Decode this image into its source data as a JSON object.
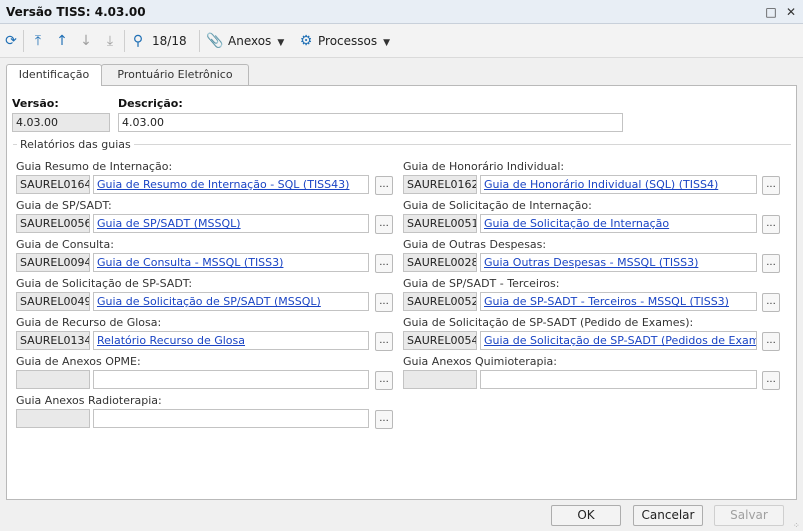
{
  "window": {
    "title": "Versão TISS: 4.03.00",
    "maximize_icon": "maximize-icon",
    "close_icon": "close-icon"
  },
  "toolbar": {
    "refresh_icon": "refresh-icon",
    "first_icon": "first-record-icon",
    "prev_icon": "previous-record-icon",
    "next_icon": "next-record-icon",
    "last_icon": "last-record-icon",
    "search_icon": "search-icon",
    "record_position": "18/18",
    "attachments_label": "Anexos",
    "processes_label": "Processos"
  },
  "tabs": [
    {
      "label": "Identificação",
      "active": true
    },
    {
      "label": "Prontuário Eletrônico",
      "active": false
    }
  ],
  "form": {
    "version_label": "Versão:",
    "version_value": "4.03.00",
    "description_label": "Descrição:",
    "description_value": "4.03.00",
    "group_caption": "Relatórios das guias",
    "lookup_button": "..."
  },
  "guides": [
    {
      "label": "Guia Resumo de Internação:",
      "code": "SAUREL0164",
      "report": "Guia de Resumo de Internação - SQL (TISS43)"
    },
    {
      "label": "Guia de Honorário Individual:",
      "code": "SAUREL0162",
      "report": "Guia de Honorário Individual (SQL) (TISS4)"
    },
    {
      "label": "Guia de SP/SADT:",
      "code": "SAUREL0056",
      "report": "Guia de SP/SADT (MSSQL)"
    },
    {
      "label": "Guia de  Solicitação de Internação:",
      "code": "SAUREL0051",
      "report": "Guia de Solicitação de Internação"
    },
    {
      "label": "Guia de Consulta:",
      "code": "SAUREL0094",
      "report": "Guia de Consulta - MSSQL (TISS3)"
    },
    {
      "label": "Guia de  Outras Despesas:",
      "code": "SAUREL0028",
      "report": "Guia Outras Despesas - MSSQL (TISS3)"
    },
    {
      "label": "Guia de  Solicitação de SP-SADT:",
      "code": "SAUREL0049",
      "report": "Guia de Solicitação de SP/SADT (MSSQL)"
    },
    {
      "label": "Guia de SP/SADT - Terceiros:",
      "code": "SAUREL0052",
      "report": "Guia de SP-SADT - Terceiros - MSSQL (TISS3)"
    },
    {
      "label": "Guia de Recurso de Glosa:",
      "code": "SAUREL0134",
      "report": "Relatório Recurso de Glosa"
    },
    {
      "label": "Guia de Solicitação de SP-SADT (Pedido de Exames):",
      "code": "SAUREL0054",
      "report": "Guia de Solicitação de SP-SADT (Pedidos de Exames) - M"
    },
    {
      "label": "Guia de Anexos OPME:",
      "code": "",
      "report": ""
    },
    {
      "label": "Guia Anexos Quimioterapia:",
      "code": "",
      "report": ""
    },
    {
      "label": "Guia Anexos Radioterapia:",
      "code": "",
      "report": ""
    }
  ],
  "footer": {
    "ok": "OK",
    "cancel": "Cancelar",
    "save": "Salvar"
  }
}
